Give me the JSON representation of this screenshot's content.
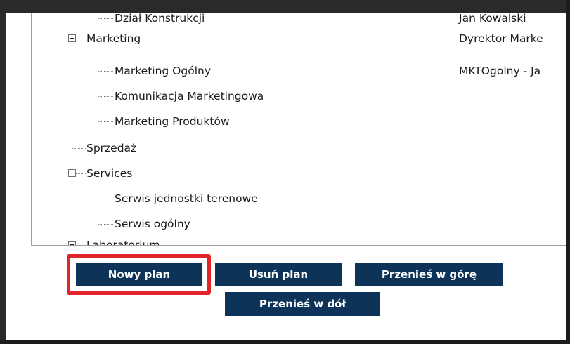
{
  "tree": {
    "rows": [
      {
        "label": "Dział Konstrukcji",
        "description": "Jan Kowalski"
      },
      {
        "label": "Marketing",
        "description": "Dyrektor Marke"
      },
      {
        "label": "Marketing Ogólny",
        "description": "MKTOgolny - Ja"
      },
      {
        "label": "Komunikacja Marketingowa",
        "description": ""
      },
      {
        "label": "Marketing Produktów",
        "description": ""
      },
      {
        "label": "Sprzedaż",
        "description": ""
      },
      {
        "label": "Services",
        "description": ""
      },
      {
        "label": "Serwis jednostki terenowe",
        "description": ""
      },
      {
        "label": "Serwis ogólny",
        "description": ""
      },
      {
        "label": "Laboratorium",
        "description": ""
      }
    ]
  },
  "buttons": {
    "new_plan": "Nowy plan",
    "delete_plan": "Usuń plan",
    "move_up": "Przenieś w górę",
    "move_down": "Przenieś w dół"
  },
  "colors": {
    "button_bg": "#0d3358",
    "highlight": "#e0242a"
  }
}
